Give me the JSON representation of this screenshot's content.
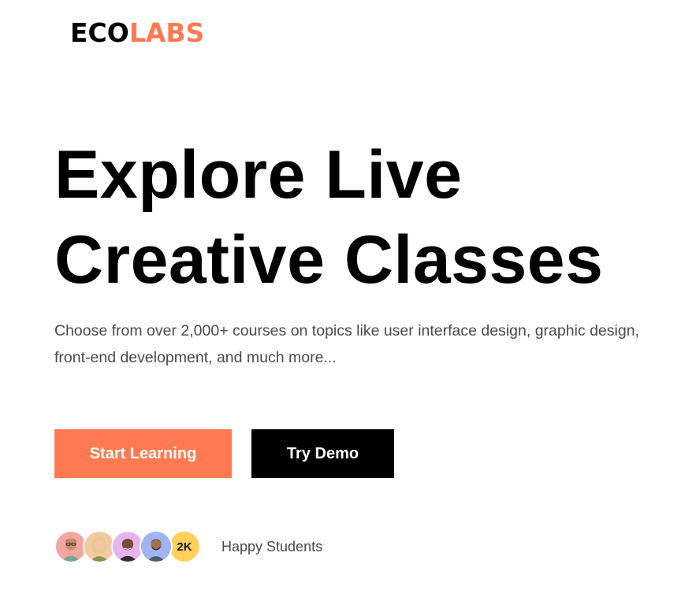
{
  "brand": {
    "logo_part1": "ECO",
    "logo_part2": "LABS",
    "accent_color": "#ff7a52"
  },
  "hero": {
    "title_line1": "Explore Live",
    "title_line2": "Creative Classes",
    "description": "Choose from over 2,000+ courses on topics like user interface design, graphic design, front-end development, and much more..."
  },
  "actions": {
    "primary_label": "Start Learning",
    "secondary_label": "Try Demo"
  },
  "social_proof": {
    "avatars": [
      {
        "name": "student-avatar-1",
        "bg": "#f4a6a0"
      },
      {
        "name": "student-avatar-2",
        "bg": "#f2c9a0"
      },
      {
        "name": "student-avatar-3",
        "bg": "#e8b4f0"
      },
      {
        "name": "student-avatar-4",
        "bg": "#9fb4f0"
      }
    ],
    "count": "2K",
    "count_color": "#ffd15c",
    "label": "Happy Students"
  }
}
